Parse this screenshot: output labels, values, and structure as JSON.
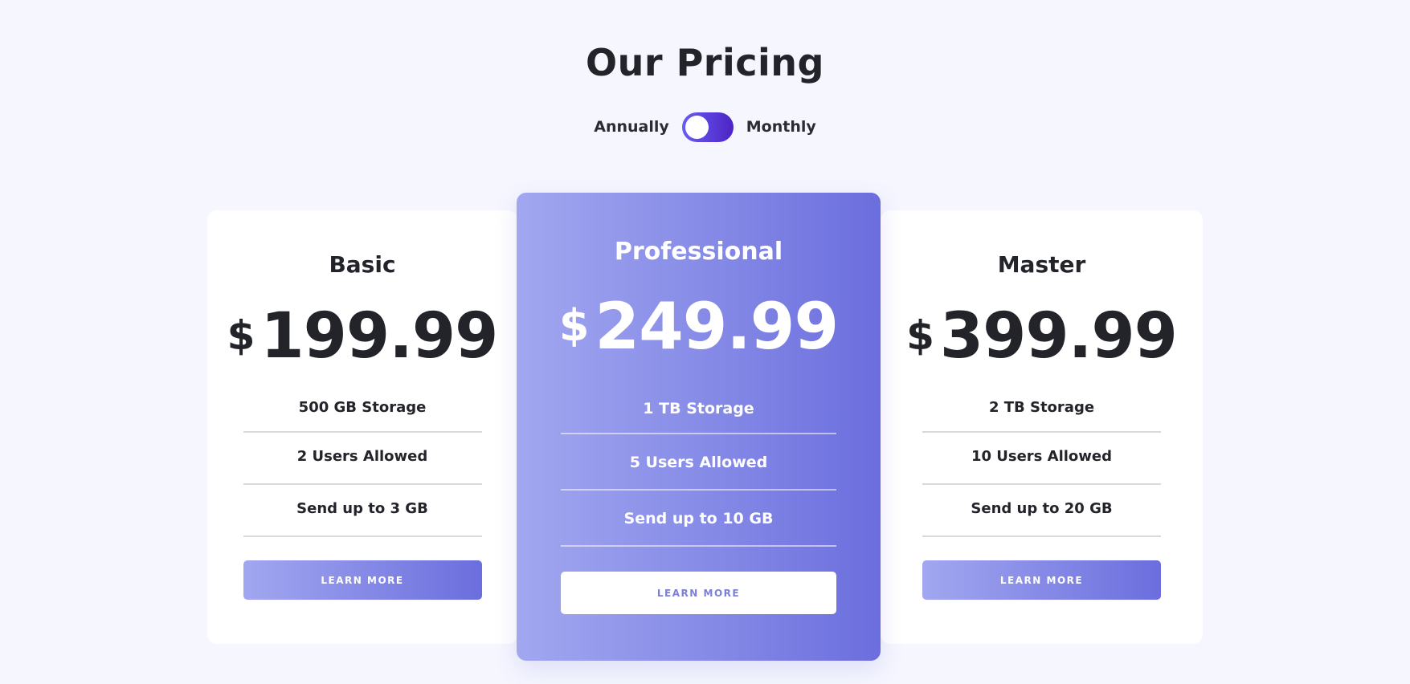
{
  "header": {
    "title": "Our Pricing"
  },
  "billing_toggle": {
    "left_label": "Annually",
    "right_label": "Monthly",
    "state": "monthly"
  },
  "plans": [
    {
      "name": "Basic",
      "currency": "$",
      "price": "199.99",
      "features": [
        "500 GB Storage",
        "2 Users Allowed",
        "Send up to 3 GB"
      ],
      "button_label": "LEARN MORE"
    },
    {
      "name": "Professional",
      "currency": "$",
      "price": "249.99",
      "features": [
        "1 TB Storage",
        "5 Users Allowed",
        "Send up to 10 GB"
      ],
      "button_label": "LEARN MORE"
    },
    {
      "name": "Master",
      "currency": "$",
      "price": "399.99",
      "features": [
        "2 TB Storage",
        "10 Users Allowed",
        "Send up to 20 GB"
      ],
      "button_label": "LEARN MORE"
    }
  ],
  "colors": {
    "background": "#f5f6fe",
    "accent_gradient_start": "#a2a7f0",
    "accent_gradient_end": "#6b6edd",
    "toggle": "#4d23c5",
    "text_dark": "#23242a"
  }
}
